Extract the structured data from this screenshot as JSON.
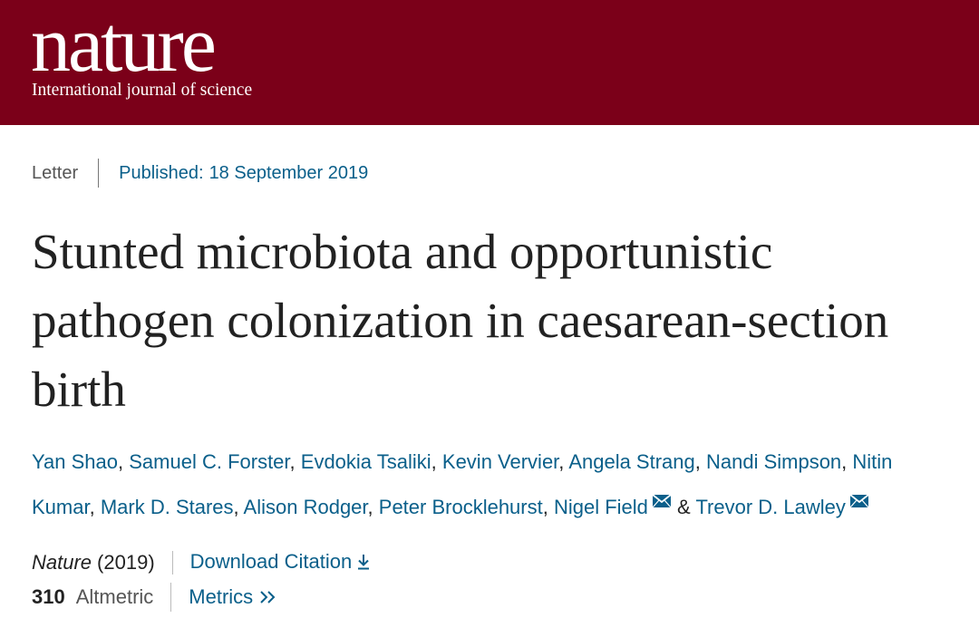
{
  "header": {
    "logo": "nature",
    "tagline": "International journal of science",
    "background": "#7b0019"
  },
  "article": {
    "type": "Letter",
    "published_label": "Published:",
    "published_date": "18 September 2019",
    "title": "Stunted microbiota and opportunistic pathogen colonization in caesarean-section birth",
    "authors": [
      "Yan Shao",
      "Samuel C. Forster",
      "Evdokia Tsaliki",
      "Kevin Vervier",
      "Angela Strang",
      "Nandi Simpson",
      "Nitin Kumar",
      "Mark D. Stares",
      "Alison Rodger",
      "Peter Brocklehurst",
      "Nigel Field",
      "Trevor D. Lawley"
    ],
    "author_connector": "&",
    "corresponding_icon": "envelope-icon",
    "journal": "Nature",
    "year": "(2019)",
    "download_citation": "Download Citation",
    "download_icon": "download-arrow-icon",
    "altmetric_count": "310",
    "altmetric_label": "Altmetric",
    "metrics_label": "Metrics",
    "metrics_icon": "double-chevron-right-icon",
    "link_color": "#0a5f8a"
  }
}
